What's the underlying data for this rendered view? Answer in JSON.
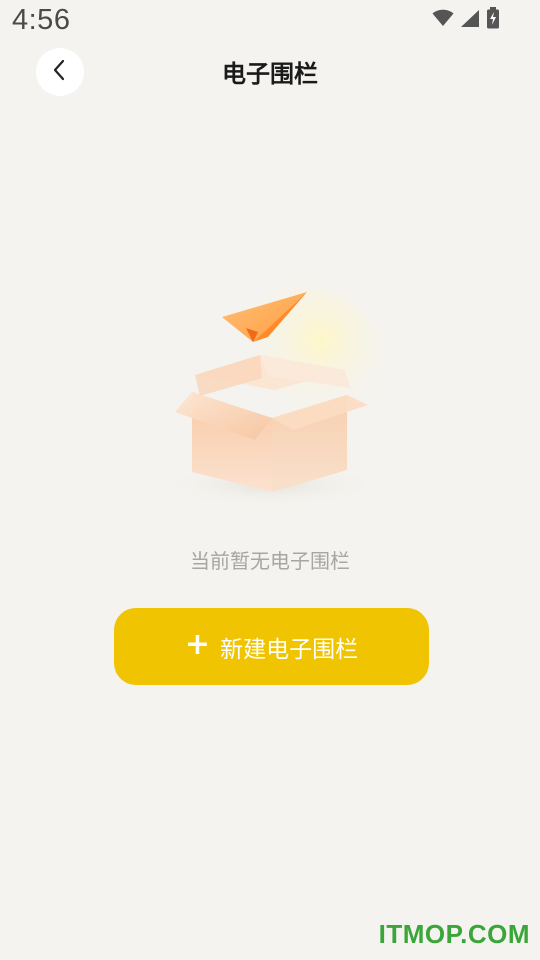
{
  "status_bar": {
    "time": "4:56",
    "icons": [
      "wifi-icon",
      "signal-icon",
      "battery-charging-icon"
    ]
  },
  "header": {
    "back_icon": "chevron-left-icon",
    "title": "电子围栏"
  },
  "empty_state": {
    "illustration": "open-box-with-paper-plane",
    "message": "当前暂无电子围栏"
  },
  "create_button": {
    "icon": "+",
    "label": "新建电子围栏"
  },
  "watermark": {
    "text": "ITMOP.COM"
  },
  "colors": {
    "background": "#f4f3ef",
    "accent": "#f0c400",
    "watermark": "#3aa63a",
    "muted_text": "#a6a6a6"
  }
}
